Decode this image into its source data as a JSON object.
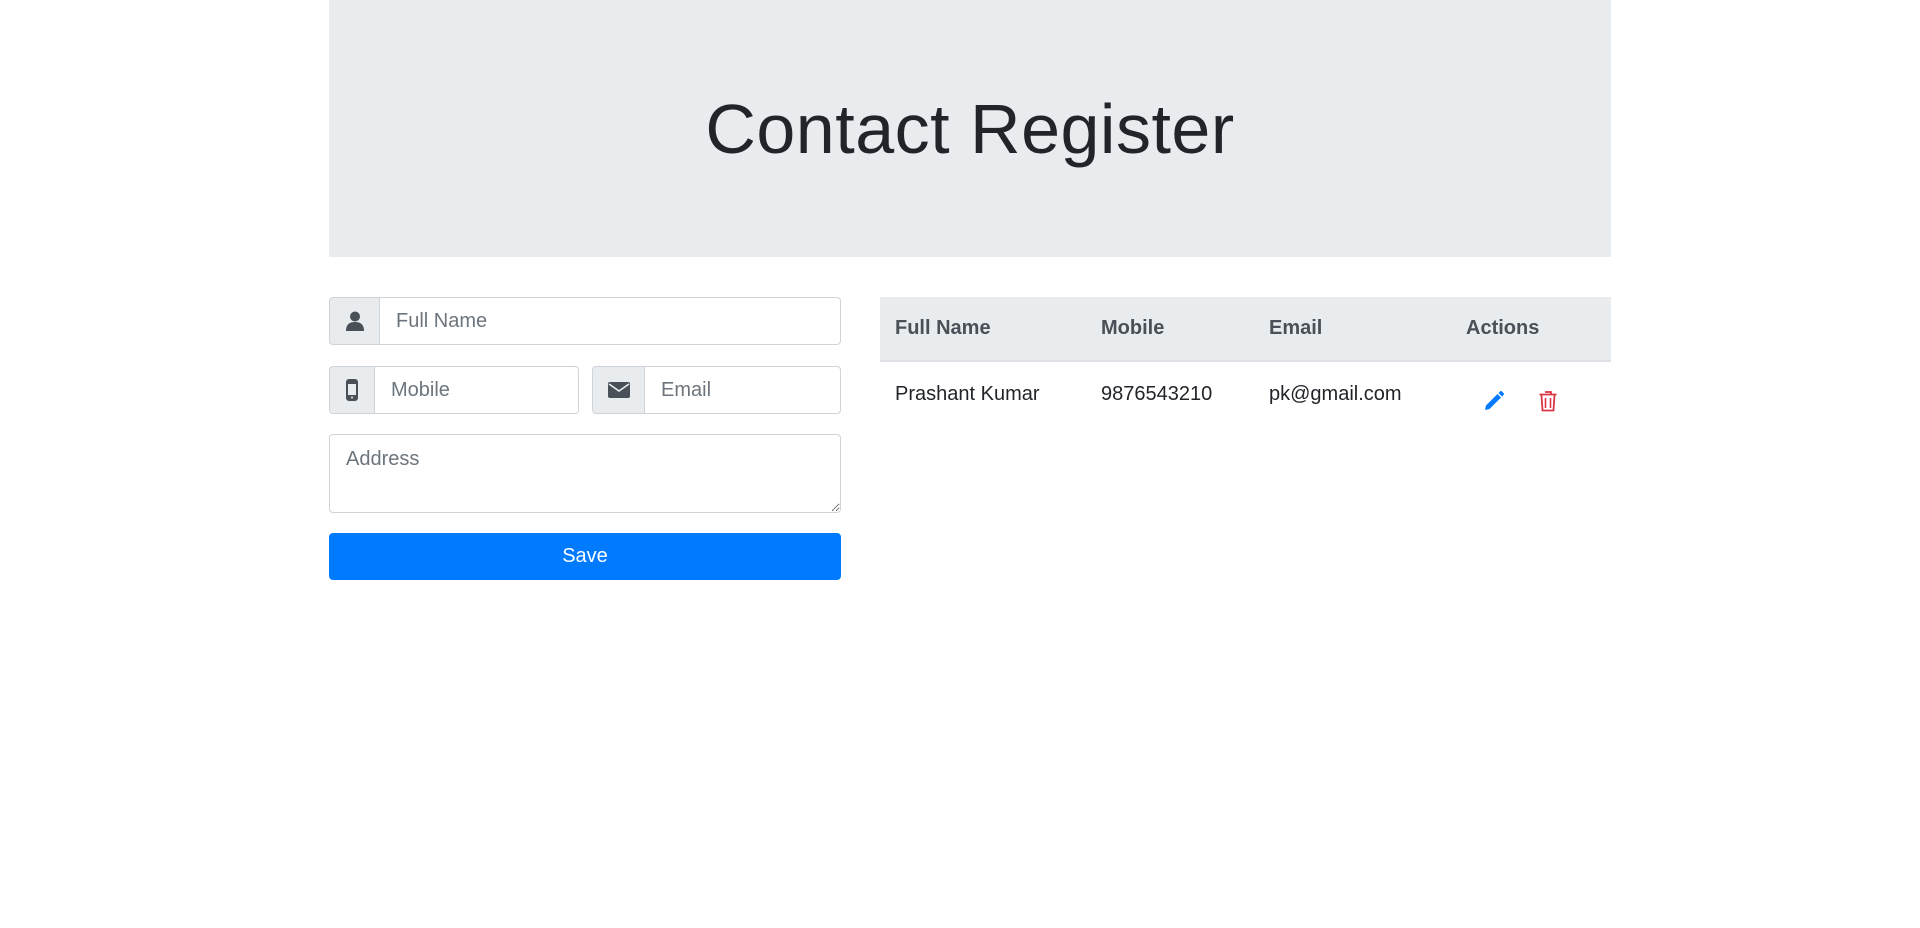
{
  "header": {
    "title": "Contact Register"
  },
  "form": {
    "full_name": {
      "placeholder": "Full Name",
      "value": ""
    },
    "mobile": {
      "placeholder": "Mobile",
      "value": ""
    },
    "email": {
      "placeholder": "Email",
      "value": ""
    },
    "address": {
      "placeholder": "Address",
      "value": ""
    },
    "save_label": "Save"
  },
  "table": {
    "columns": [
      "Full Name",
      "Mobile",
      "Email",
      "Actions"
    ],
    "rows": [
      {
        "full_name": "Prashant Kumar",
        "mobile": "9876543210",
        "email": "pk@gmail.com",
        "actions": {
          "edit_icon": "pencil-icon",
          "delete_icon": "trash-icon"
        }
      }
    ]
  },
  "colors": {
    "primary": "#007bff",
    "danger": "#dc3545",
    "jumbotron_bg": "#e9ecef",
    "table_header_bg": "#e9ecef"
  }
}
